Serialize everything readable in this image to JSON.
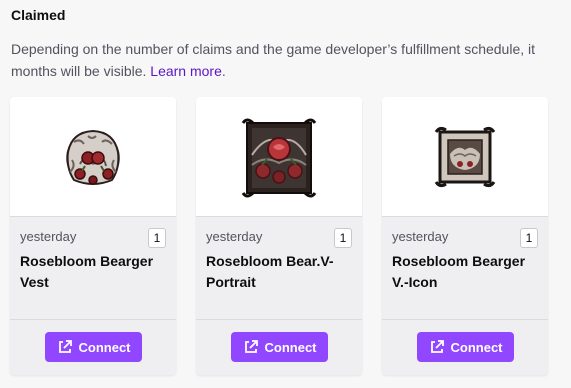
{
  "section": {
    "title": "Claimed",
    "description_line1": "Depending on the number of claims and the game developer’s fulfillment schedule, it",
    "description_line2": "months will be visible.",
    "learn_more": "Learn more",
    "period": "."
  },
  "cards": [
    {
      "date": "yesterday",
      "count": "1",
      "name": "Rosebloom Bearger Vest",
      "button": "Connect",
      "icon": "rosebloom-bearger-vest-image"
    },
    {
      "date": "yesterday",
      "count": "1",
      "name": "Rosebloom Bear.V-Portrait",
      "button": "Connect",
      "icon": "rosebloom-portrait-image"
    },
    {
      "date": "yesterday",
      "count": "1",
      "name": "Rosebloom Bearger V.-Icon",
      "button": "Connect",
      "icon": "rosebloom-icon-image"
    }
  ],
  "colors": {
    "accent": "#9147ff",
    "link": "#5c16c5",
    "card_bg": "#efeff1"
  }
}
